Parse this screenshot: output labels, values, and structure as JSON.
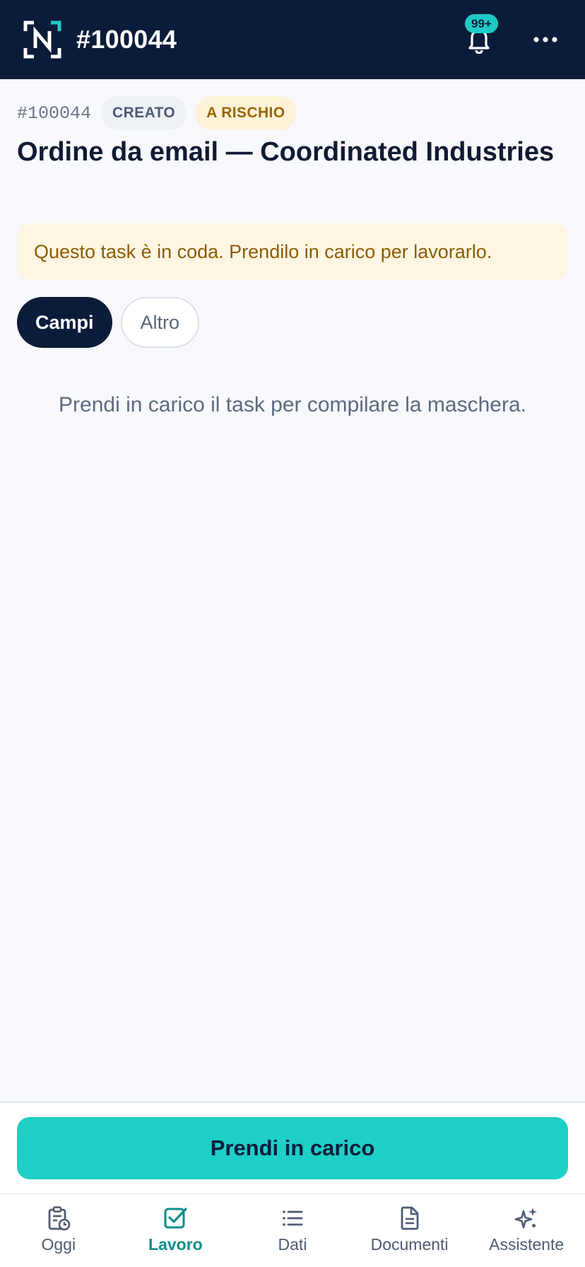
{
  "header": {
    "title": "#100044",
    "notification_count": "99+",
    "colors": {
      "background": "#0b1c3a",
      "accent": "#1ecbc4"
    }
  },
  "task": {
    "id": "#100044",
    "status_badge": "CREATO",
    "risk_badge": "A RISCHIO",
    "title": "Ordine da email — Coordinated Industries",
    "queue_notice": "Questo task è in coda. Prendilo in carico per lavorarlo."
  },
  "tabs": [
    {
      "label": "Campi",
      "active": true
    },
    {
      "label": "Altro",
      "active": false
    }
  ],
  "empty_message": "Prendi in carico il task per compilare la maschera.",
  "primary_action": {
    "label": "Prendi in carico",
    "color": "#1ecfc6"
  },
  "bottom_nav": [
    {
      "label": "Oggi",
      "icon": "clipboard-clock-icon",
      "active": false
    },
    {
      "label": "Lavoro",
      "icon": "checkbox-icon",
      "active": true
    },
    {
      "label": "Dati",
      "icon": "list-icon",
      "active": false
    },
    {
      "label": "Documenti",
      "icon": "document-icon",
      "active": false
    },
    {
      "label": "Assistente",
      "icon": "sparkle-icon",
      "active": false
    }
  ]
}
